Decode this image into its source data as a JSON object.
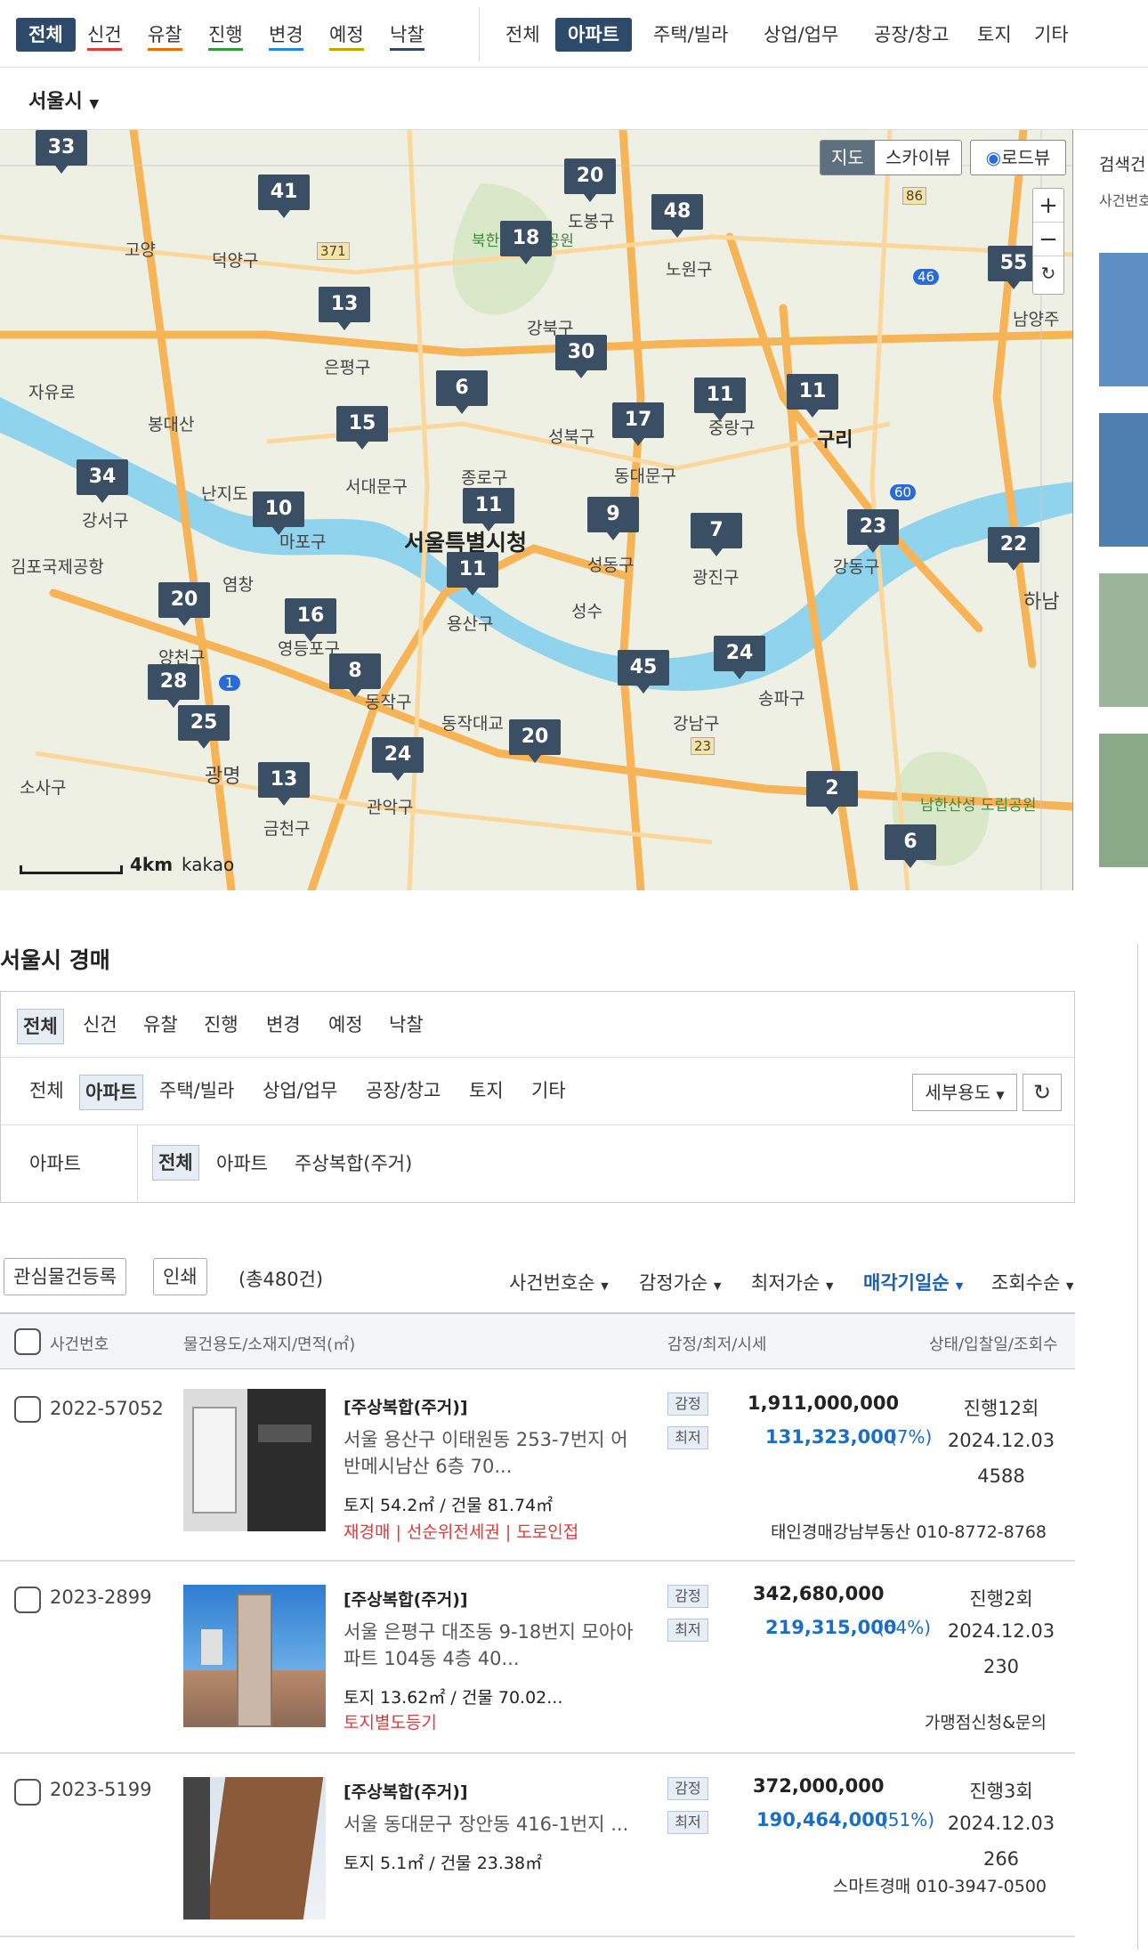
{
  "status_tabs": [
    "전체",
    "신건",
    "유찰",
    "진행",
    "변경",
    "예정",
    "낙찰"
  ],
  "status_colors": [
    "#2e4a6b",
    "#e53935",
    "#ef6c00",
    "#2e9b3f",
    "#1e88e5",
    "#c8a400",
    "#2e4a6b"
  ],
  "type_tabs": [
    "전체",
    "아파트",
    "주택/빌라",
    "상업/업무",
    "공장/창고",
    "토지",
    "기타"
  ],
  "region": "서울시",
  "map": {
    "type_buttons": [
      "지도",
      "스카이뷰"
    ],
    "roadview": "로드뷰",
    "zoom_in": "+",
    "zoom_out": "−",
    "scale": "4km",
    "brand": "kakao",
    "markers": [
      "33",
      "41",
      "20",
      "48",
      "18",
      "13",
      "55",
      "30",
      "6",
      "15",
      "17",
      "11",
      "11",
      "34",
      "10",
      "11",
      "9",
      "7",
      "23",
      "22",
      "11",
      "20",
      "16",
      "8",
      "45",
      "24",
      "28",
      "25",
      "13",
      "24",
      "20",
      "2",
      "6"
    ],
    "labels": [
      "고양",
      "덕양구",
      "북한산 국립공원",
      "도봉구",
      "노원구",
      "강북구",
      "은평구",
      "남양주",
      "자유로",
      "봉대산",
      "성북구",
      "중랑구",
      "구리",
      "서대문구",
      "종로구",
      "동대문구",
      "강서구",
      "난지도",
      "마포구",
      "서울특별시청",
      "성동구",
      "광진구",
      "강동구",
      "하남",
      "김포국제공항",
      "염창",
      "용산구",
      "성수",
      "영등포구",
      "양천구",
      "동작구",
      "동작대교",
      "강남구",
      "송파구",
      "광명",
      "금천구",
      "관악구",
      "소사구",
      "남한산성 도립공원",
      "371",
      "86",
      "46",
      "60",
      "23",
      "1"
    ]
  },
  "side": {
    "title": "검색건",
    "sub": "사건번호"
  },
  "page_title": "서울시 경매",
  "filter": {
    "status": [
      "전체",
      "신건",
      "유찰",
      "진행",
      "변경",
      "예정",
      "낙찰"
    ],
    "types": [
      "전체",
      "아파트",
      "주택/빌라",
      "상업/업무",
      "공장/창고",
      "토지",
      "기타"
    ],
    "detail_select": "세부용도",
    "sub_label": "아파트",
    "sub_opts": [
      "전체",
      "아파트",
      "주상복합(주거)"
    ]
  },
  "toolbar": {
    "watch": "관심물건등록",
    "print": "인쇄",
    "total": "(총480건)"
  },
  "sorts": [
    "사건번호순",
    "감정가순",
    "최저가순",
    "매각기일순",
    "조회수순"
  ],
  "table_head": {
    "case": "사건번호",
    "use": "물건용도/소재지/면적(㎡)",
    "price": "감정/최저/시세",
    "status": "상태/입찰일/조회수"
  },
  "badge": {
    "appraisal": "감정",
    "minimum": "최저"
  },
  "rows": [
    {
      "case": "2022-57052",
      "use": "[주상복합(주거)]",
      "addr": "서울 용산구 이태원동 253-7번지 어반메시남산 6층 70...",
      "area": "토지 54.2㎡ / 건물 81.74㎡",
      "tags": "재경매 | 선순위전세권 | 도로인접",
      "appraisal": "1,911,000,000",
      "min": "131,323,000",
      "pct": "(7%)",
      "status": "진행12회",
      "date": "2024.12.03",
      "views": "4588",
      "agent": "태인경매강남부동산 010-8772-8768"
    },
    {
      "case": "2023-2899",
      "use": "[주상복합(주거)]",
      "addr": "서울 은평구 대조동 9-18번지 모아아파트 104동 4층 40...",
      "area": "토지 13.62㎡ / 건물 70.02...",
      "tags": "토지별도등기",
      "appraisal": "342,680,000",
      "min": "219,315,000",
      "pct": "(64%)",
      "status": "진행2회",
      "date": "2024.12.03",
      "views": "230",
      "agent": "가맹점신청&문의"
    },
    {
      "case": "2023-5199",
      "use": "[주상복합(주거)]",
      "addr": "서울 동대문구 장안동 416-1번지 ...",
      "area": "토지 5.1㎡ / 건물 23.38㎡",
      "tags": "",
      "appraisal": "372,000,000",
      "min": "190,464,000",
      "pct": "(51%)",
      "status": "진행3회",
      "date": "2024.12.03",
      "views": "266",
      "agent": "스마트경매 010-3947-0500"
    }
  ]
}
